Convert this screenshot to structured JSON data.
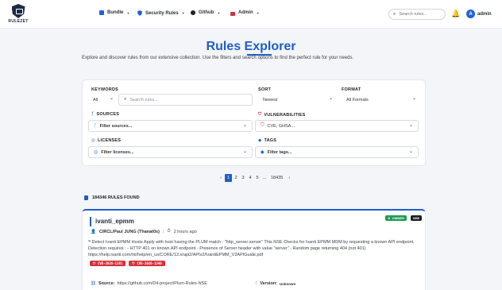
{
  "brand": {
    "name": "RULEZET"
  },
  "nav": {
    "items": [
      {
        "label": "Bundle",
        "icon": "bundle-icon"
      },
      {
        "label": "Security Rules",
        "icon": "shield-icon"
      },
      {
        "label": "Github",
        "icon": "github-icon"
      },
      {
        "label": "Admin",
        "icon": "lock-icon"
      }
    ],
    "search_placeholder": "Search rules...",
    "avatar_initial": "A",
    "user": "admin"
  },
  "hero": {
    "title": "Rules Explorer",
    "subtitle": "Explore and discover rules from our extensive collection. Use the filters and search options to find the perfect rule for your needs."
  },
  "filters": {
    "keywords_label": "KEYWORDS",
    "keywords_scope": "All",
    "search_placeholder": "Search rules...",
    "sort_label": "SORT",
    "sort_value": "Newest",
    "format_label": "FORMAT",
    "format_value": "All Formats",
    "sources_label": "SOURCES",
    "sources_placeholder": "Filter sources...",
    "vulns_label": "VULNERABILITIES",
    "vulns_value": "CVE, GHSA...",
    "licenses_label": "LICENSES",
    "licenses_placeholder": "Filter licenses...",
    "tags_label": "TAGS",
    "tags_placeholder": "Filter tags..."
  },
  "pagination": {
    "prev": "‹",
    "pages": [
      "1",
      "2",
      "3",
      "4",
      "5",
      "...",
      "18435"
    ],
    "next": "›",
    "current": "1"
  },
  "results": {
    "count": "184346 RULES FOUND"
  },
  "rule": {
    "title": "ivanti_epmm",
    "owner_badge": "OWNER",
    "format_badge": "NSE",
    "author": "CIRCL/Paul JUNG (Thanat0s)",
    "time": "2 hours ago",
    "description": "Detect Ivanti EPMM Hosts  Apply with host having the PLUM match : \"http_server:server\"  This NSE Checks for Ivanti EPMM MDM by requesting a known API endpoint. Detection requires : - HTTP 401 on known API endpoint - Presence of Server header with value \"server\" - Random page returning 404 (not 401)  https://help.ivanti.com/mi/help/en_us/CORE/12.x/api2/APIv2/IvantiEPMM_V2APIGuide.pdf",
    "cves": [
      "CVE-2026-1281",
      "CVE-2026-1340"
    ],
    "source_label": "Source:",
    "source_value": "https://github.com/D4-project/Plum-Rules-NSE",
    "version_label": "Version:",
    "version_value": "Unknown"
  },
  "colors": {
    "accent": "#1f5ec9",
    "danger": "#d6303a",
    "owner": "#1c9b55",
    "dark": "#1b1f25"
  }
}
